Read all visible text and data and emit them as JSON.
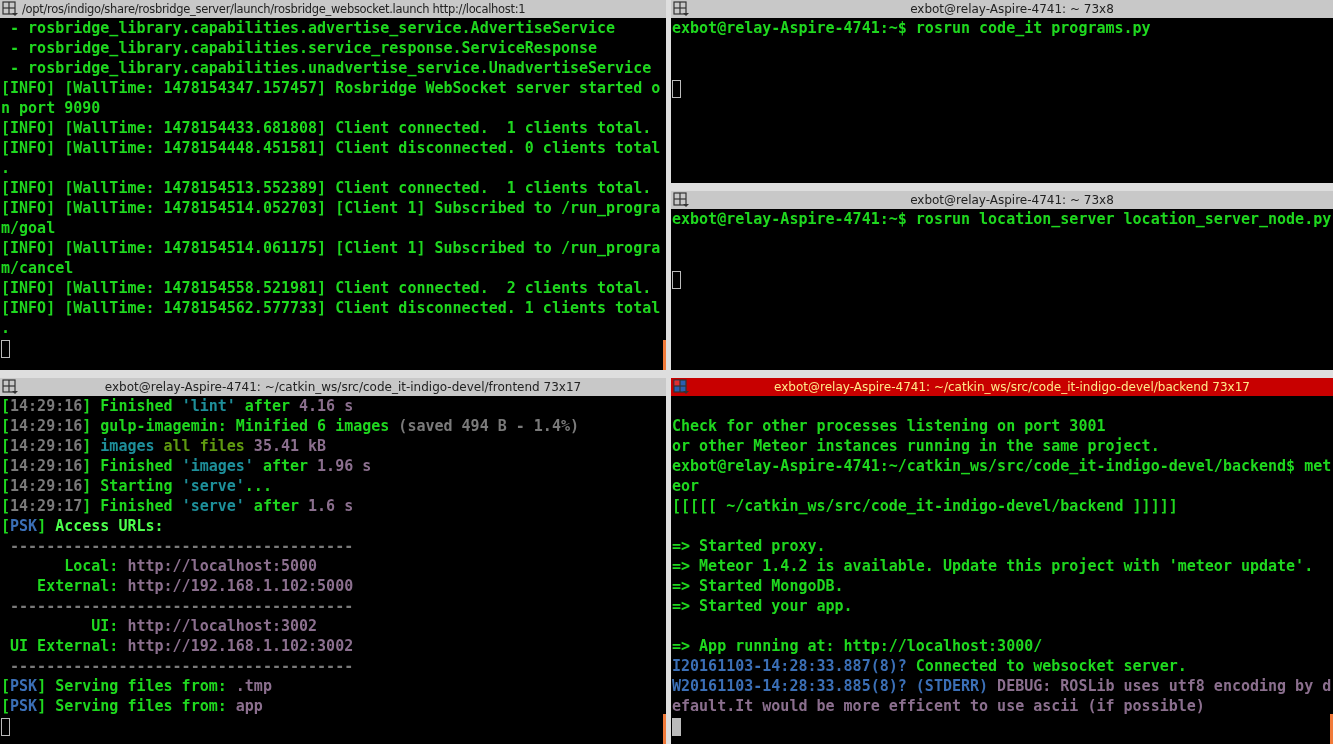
{
  "panes": [
    {
      "title": "/opt/ros/indigo/share/rosbridge_server/launch/rosbridge_websocket.launch http://localhost:1",
      "focused": false,
      "scrolled": true,
      "lines": [
        {
          "kind": "text",
          "segments": [
            {
              "text": " - rosbridge_library.capabilities.advertise_service.AdvertiseService"
            }
          ]
        },
        {
          "kind": "text",
          "segments": [
            {
              "text": " - rosbridge_library.capabilities.service_response.ServiceResponse"
            }
          ]
        },
        {
          "kind": "text",
          "segments": [
            {
              "text": " - rosbridge_library.capabilities.unadvertise_service.UnadvertiseService"
            }
          ]
        },
        {
          "kind": "text",
          "segments": [
            {
              "text": "[INFO] [WallTime: 1478154347.157457] Rosbridge WebSocket server started o"
            }
          ]
        },
        {
          "kind": "text",
          "segments": [
            {
              "text": "n port 9090"
            }
          ]
        },
        {
          "kind": "text",
          "segments": [
            {
              "text": "[INFO] [WallTime: 1478154433.681808] Client connected.  1 clients total."
            }
          ]
        },
        {
          "kind": "text",
          "segments": [
            {
              "text": "[INFO] [WallTime: 1478154448.451581] Client disconnected. 0 clients total"
            }
          ]
        },
        {
          "kind": "text",
          "segments": [
            {
              "text": "."
            }
          ]
        },
        {
          "kind": "text",
          "segments": [
            {
              "text": "[INFO] [WallTime: 1478154513.552389] Client connected.  1 clients total."
            }
          ]
        },
        {
          "kind": "text",
          "segments": [
            {
              "text": "[INFO] [WallTime: 1478154514.052703] [Client 1] Subscribed to /run_progra"
            }
          ]
        },
        {
          "kind": "text",
          "segments": [
            {
              "text": "m/goal"
            }
          ]
        },
        {
          "kind": "text",
          "segments": [
            {
              "text": "[INFO] [WallTime: 1478154514.061175] [Client 1] Subscribed to /run_progra"
            }
          ]
        },
        {
          "kind": "text",
          "segments": [
            {
              "text": "m/cancel"
            }
          ]
        },
        {
          "kind": "text",
          "segments": [
            {
              "text": "[INFO] [WallTime: 1478154558.521981] Client connected.  2 clients total."
            }
          ]
        },
        {
          "kind": "text",
          "segments": [
            {
              "text": "[INFO] [WallTime: 1478154562.577733] Client disconnected. 1 clients total"
            }
          ]
        },
        {
          "kind": "text",
          "segments": [
            {
              "text": "."
            }
          ]
        }
      ]
    },
    {
      "title": "exbot@relay-Aspire-4741: ~ 73x8",
      "focused": false,
      "scrolled": false,
      "lines": [
        {
          "kind": "text",
          "segments": [
            {
              "text": "exbot@relay-Aspire-4741:~$ rosrun code_it programs.py"
            }
          ]
        },
        {
          "kind": "blank"
        },
        {
          "kind": "blank"
        }
      ]
    },
    {
      "title": "exbot@relay-Aspire-4741: ~ 73x8",
      "focused": false,
      "scrolled": false,
      "lines": [
        {
          "kind": "text",
          "segments": [
            {
              "text": "exbot@relay-Aspire-4741:~$ rosrun location_server location_server_node.py"
            }
          ]
        },
        {
          "kind": "blank"
        },
        {
          "kind": "blank"
        }
      ]
    },
    {
      "title": "exbot@relay-Aspire-4741: ~/catkin_ws/src/code_it-indigo-devel/frontend 73x17",
      "focused": false,
      "scrolled": true,
      "lines": [
        {
          "kind": "text",
          "segments": [
            {
              "text": "[",
              "color": "#1fd81f"
            },
            {
              "text": "14:29:16",
              "color": "#7a7a7a"
            },
            {
              "text": "] Finished ",
              "color": "#1fd81f"
            },
            {
              "text": "'lint'",
              "color": "#1e8f9a"
            },
            {
              "text": " after ",
              "color": "#1fd81f"
            },
            {
              "text": "4.16 s",
              "color": "#8b6f8e"
            }
          ]
        },
        {
          "kind": "text",
          "segments": [
            {
              "text": "[",
              "color": "#1fd81f"
            },
            {
              "text": "14:29:16",
              "color": "#7a7a7a"
            },
            {
              "text": "] gulp-imagemin: Minified 6 images",
              "color": "#1fd81f"
            },
            {
              "text": " (saved 494 B - 1.4%)",
              "color": "#7a7a7a"
            }
          ]
        },
        {
          "kind": "text",
          "segments": [
            {
              "text": "[",
              "color": "#1fd81f"
            },
            {
              "text": "14:29:16",
              "color": "#7a7a7a"
            },
            {
              "text": "] ",
              "color": "#1fd81f"
            },
            {
              "text": "images",
              "color": "#1e8f9a"
            },
            {
              "text": " all files",
              "color": "#5f9a10"
            },
            {
              "text": " 35.41 kB",
              "color": "#8b6f8e"
            }
          ]
        },
        {
          "kind": "text",
          "segments": [
            {
              "text": "[",
              "color": "#1fd81f"
            },
            {
              "text": "14:29:16",
              "color": "#7a7a7a"
            },
            {
              "text": "] Finished ",
              "color": "#1fd81f"
            },
            {
              "text": "'images'",
              "color": "#1e8f9a"
            },
            {
              "text": " after ",
              "color": "#1fd81f"
            },
            {
              "text": "1.96 s",
              "color": "#8b6f8e"
            }
          ]
        },
        {
          "kind": "text",
          "segments": [
            {
              "text": "[",
              "color": "#1fd81f"
            },
            {
              "text": "14:29:16",
              "color": "#7a7a7a"
            },
            {
              "text": "] Starting ",
              "color": "#1fd81f"
            },
            {
              "text": "'serve'",
              "color": "#1e8f9a"
            },
            {
              "text": "...",
              "color": "#1fd81f"
            }
          ]
        },
        {
          "kind": "text",
          "segments": [
            {
              "text": "[",
              "color": "#1fd81f"
            },
            {
              "text": "14:29:17",
              "color": "#7a7a7a"
            },
            {
              "text": "] Finished ",
              "color": "#1fd81f"
            },
            {
              "text": "'serve'",
              "color": "#1e8f9a"
            },
            {
              "text": " after ",
              "color": "#1fd81f"
            },
            {
              "text": "1.6 s",
              "color": "#8b6f8e"
            }
          ]
        },
        {
          "kind": "text",
          "segments": [
            {
              "text": "[",
              "color": "#1fd81f"
            },
            {
              "text": "PSK",
              "color": "#3b6fb6"
            },
            {
              "text": "] ",
              "color": "#1fd81f"
            },
            {
              "text": "Access URLs:",
              "color": "#4dff4d"
            }
          ]
        },
        {
          "kind": "text",
          "segments": [
            {
              "text": " --------------------------------------",
              "color": "#7a7a7a"
            }
          ]
        },
        {
          "kind": "text",
          "segments": [
            {
              "text": "       Local: ",
              "color": "#1fd81f"
            },
            {
              "text": "http://localhost:5000",
              "color": "#8b6f8e"
            }
          ]
        },
        {
          "kind": "text",
          "segments": [
            {
              "text": "    External: ",
              "color": "#1fd81f"
            },
            {
              "text": "http://192.168.1.102:5000",
              "color": "#8b6f8e"
            }
          ]
        },
        {
          "kind": "text",
          "segments": [
            {
              "text": " --------------------------------------",
              "color": "#7a7a7a"
            }
          ]
        },
        {
          "kind": "text",
          "segments": [
            {
              "text": "          UI: ",
              "color": "#1fd81f"
            },
            {
              "text": "http://localhost:3002",
              "color": "#8b6f8e"
            }
          ]
        },
        {
          "kind": "text",
          "segments": [
            {
              "text": " UI External: ",
              "color": "#1fd81f"
            },
            {
              "text": "http://192.168.1.102:3002",
              "color": "#8b6f8e"
            }
          ]
        },
        {
          "kind": "text",
          "segments": [
            {
              "text": " --------------------------------------",
              "color": "#7a7a7a"
            }
          ]
        },
        {
          "kind": "text",
          "segments": [
            {
              "text": "[",
              "color": "#1fd81f"
            },
            {
              "text": "PSK",
              "color": "#3b6fb6"
            },
            {
              "text": "] Serving files from: ",
              "color": "#1fd81f"
            },
            {
              "text": ".tmp",
              "color": "#8b6f8e"
            }
          ]
        },
        {
          "kind": "text",
          "segments": [
            {
              "text": "[",
              "color": "#1fd81f"
            },
            {
              "text": "PSK",
              "color": "#3b6fb6"
            },
            {
              "text": "] Serving files from: ",
              "color": "#1fd81f"
            },
            {
              "text": "app",
              "color": "#8b6f8e"
            }
          ]
        }
      ]
    },
    {
      "title": "exbot@relay-Aspire-4741: ~/catkin_ws/src/code_it-indigo-devel/backend 73x17",
      "focused": true,
      "scrolled": true,
      "lines": [
        {
          "kind": "blank"
        },
        {
          "kind": "text",
          "segments": [
            {
              "text": "Check for other processes listening on port 3001"
            }
          ]
        },
        {
          "kind": "text",
          "segments": [
            {
              "text": "or other Meteor instances running in the same project."
            }
          ]
        },
        {
          "kind": "text",
          "segments": [
            {
              "text": "exbot@relay-Aspire-4741:~/catkin_ws/src/code_it-indigo-devel/backend$ met"
            }
          ]
        },
        {
          "kind": "text",
          "segments": [
            {
              "text": "eor"
            }
          ]
        },
        {
          "kind": "text",
          "segments": [
            {
              "text": "[[[[[ ~/catkin_ws/src/code_it-indigo-devel/backend ]]]]]"
            }
          ]
        },
        {
          "kind": "blank"
        },
        {
          "kind": "text",
          "segments": [
            {
              "text": "=> Started proxy."
            }
          ]
        },
        {
          "kind": "text",
          "segments": [
            {
              "text": "=> Meteor 1.4.2 is available. Update this project with 'meteor update'."
            }
          ]
        },
        {
          "kind": "text",
          "segments": [
            {
              "text": "=> Started MongoDB."
            }
          ]
        },
        {
          "kind": "text",
          "segments": [
            {
              "text": "=> Started your app."
            }
          ]
        },
        {
          "kind": "blank"
        },
        {
          "kind": "text",
          "segments": [
            {
              "text": "=> App running at: http://localhost:3000/"
            }
          ]
        },
        {
          "kind": "text",
          "segments": [
            {
              "text": "I20161103-14:28:33.887(8)?",
              "color": "#3b6fb6"
            },
            {
              "text": " Connected to websocket server.",
              "color": "#1fd81f"
            }
          ]
        },
        {
          "kind": "text",
          "segments": [
            {
              "text": "W20161103-14:28:33.885(8)? (STDERR)",
              "color": "#3b6fb6"
            },
            {
              "text": " DEBUG: ROSLib uses utf8 encoding by d",
              "color": "#8b6f8e"
            }
          ]
        },
        {
          "kind": "text",
          "segments": [
            {
              "text": "efault.It would be more efficent to use ascii (if possible)",
              "color": "#8b6f8e"
            }
          ]
        }
      ]
    }
  ]
}
